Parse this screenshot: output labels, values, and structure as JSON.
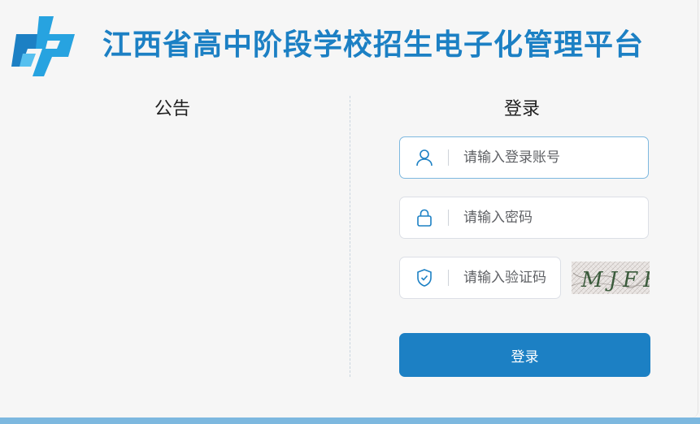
{
  "header": {
    "title": "江西省高中阶段学校招生电子化管理平台"
  },
  "notice": {
    "title": "公告"
  },
  "login": {
    "title": "登录",
    "account_placeholder": "请输入登录账号",
    "password_placeholder": "请输入密码",
    "captcha_placeholder": "请输入验证码",
    "captcha_text": "MJFR",
    "submit_label": "登录"
  },
  "colors": {
    "brand": "#1c80c4",
    "background": "#f6f6f6",
    "bottom_bar": "#7db8df"
  },
  "icons": {
    "account": "user-icon",
    "password": "lock-icon",
    "captcha": "shield-check-icon"
  }
}
